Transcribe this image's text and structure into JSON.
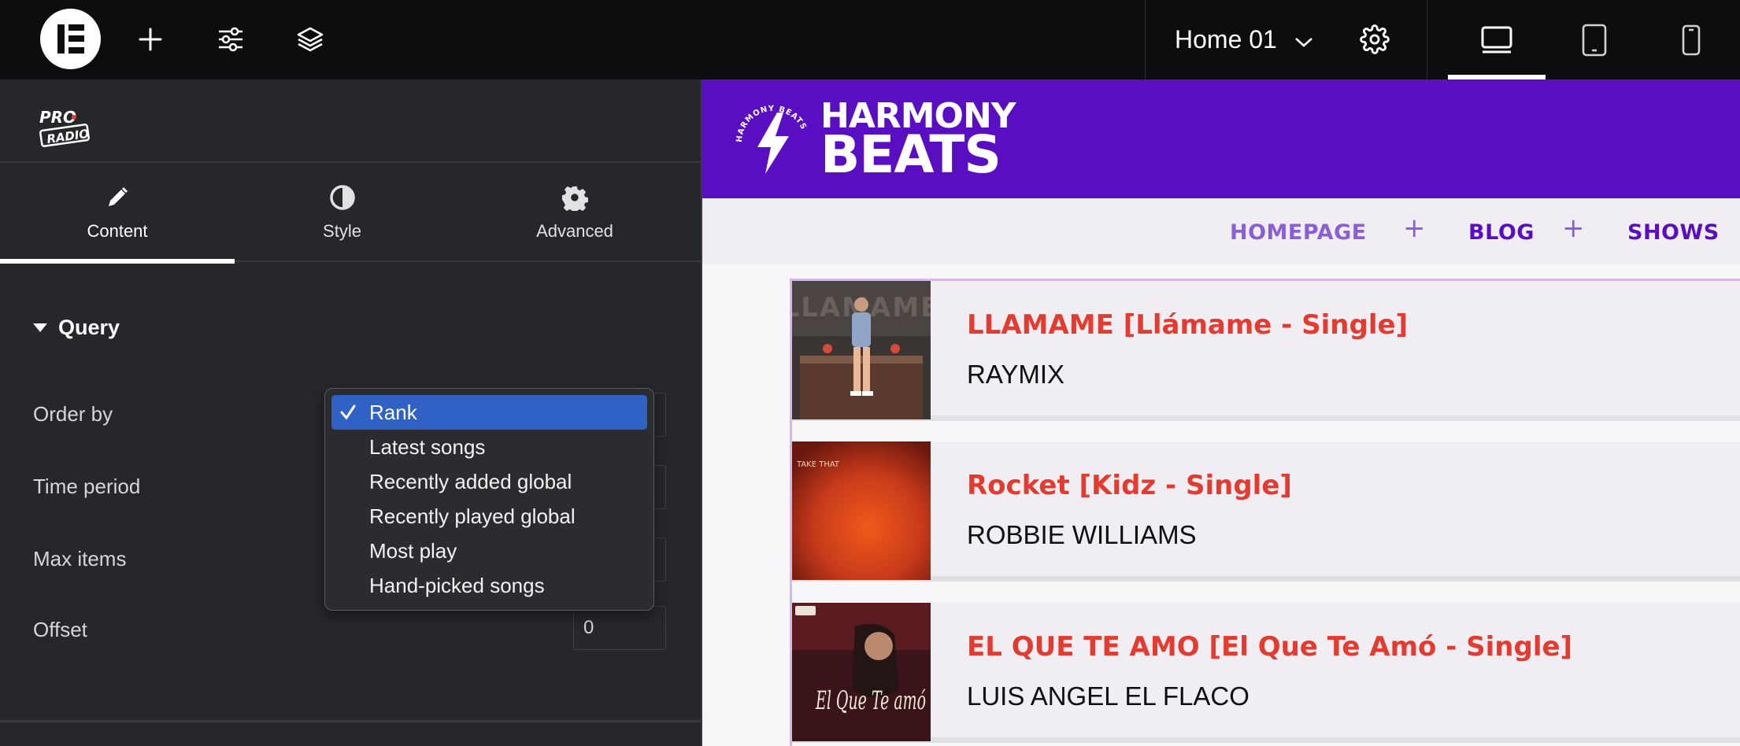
{
  "topbar": {
    "page_name": "Home 01",
    "icons": [
      "elementor-logo",
      "plus-icon",
      "sliders-icon",
      "layers-icon",
      "chevron-down-icon",
      "gear-icon",
      "desktop-icon",
      "tablet-icon",
      "mobile-icon"
    ]
  },
  "panel": {
    "logo_line1": "PRO",
    "logo_line2": "RADIO",
    "tabs": [
      {
        "label": "Content",
        "icon": "pencil-icon",
        "active": true
      },
      {
        "label": "Style",
        "icon": "contrast-icon",
        "active": false
      },
      {
        "label": "Advanced",
        "icon": "gear-icon",
        "active": false
      }
    ],
    "section": "Query",
    "controls": {
      "order_by": "Order by",
      "time_period": "Time period",
      "max_items": "Max items",
      "offset": "Offset",
      "offset_value": "0"
    },
    "dropdown": {
      "options": [
        "Rank",
        "Latest songs",
        "Recently added global",
        "Recently played global",
        "Most play",
        "Hand-picked songs"
      ],
      "selected": "Rank"
    }
  },
  "site": {
    "logo_line1": "HARMONY",
    "logo_line2": "BEATS",
    "badge_text": "HARMONY BEATS",
    "nav": [
      "HOMEPAGE",
      "BLOG",
      "SHOWS"
    ],
    "colors": {
      "brand": "#5a0ec1",
      "title": "#e33b2f",
      "nav_light": "#8a5fd6",
      "nav_dark": "#5a0ec1"
    },
    "tracks": [
      {
        "title": "LLAMAME [Llámame - Single]",
        "artist": "RAYMIX",
        "cover_text": "LLAMAME"
      },
      {
        "title": "Rocket [Kidz - Single]",
        "artist": "ROBBIE WILLIAMS",
        "cover_text": "TAKE THAT"
      },
      {
        "title": "EL QUE TE AMO [El Que Te Amó - Single]",
        "artist": "LUIS ANGEL EL FLACO",
        "cover_text": "El Que Te amó"
      }
    ]
  }
}
